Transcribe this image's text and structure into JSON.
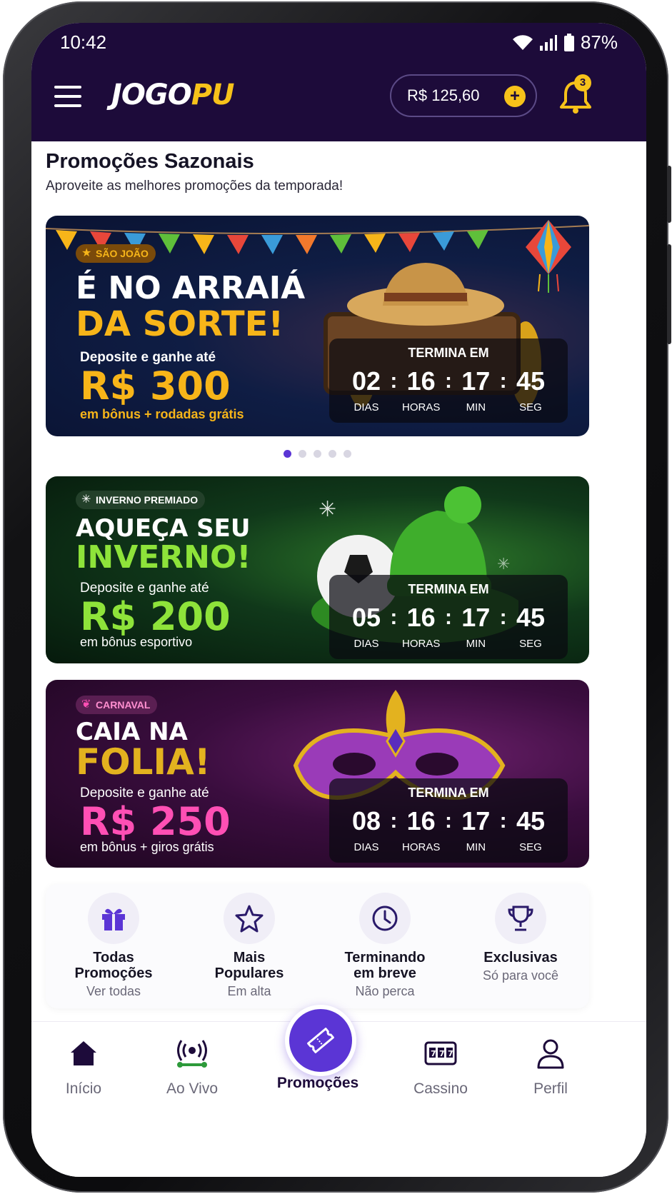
{
  "status_bar": {
    "time": "10:42",
    "battery": "87%"
  },
  "header": {
    "logo_main": "JOGO",
    "logo_accent": "PU",
    "balance": "R$ 125,60",
    "add_symbol": "+",
    "notification_count": "3"
  },
  "section": {
    "title": "Promoções Sazonais",
    "subtitle": "Aproveite as melhores promoções da temporada!"
  },
  "banners": [
    {
      "tag": "SÃO JOÃO",
      "headline_1": "É NO ARRAIÁ",
      "headline_2": "DA SORTE!",
      "deposit": "Deposite e ganhe até",
      "amount": "R$ 300",
      "amount_sub": "em bônus + rodadas grátis",
      "countdown": {
        "title": "TERMINA EM",
        "days": "02",
        "hours": "16",
        "min": "17",
        "sec": "45"
      },
      "accent": "#f7b519"
    },
    {
      "tag": "INVERNO PREMIADO",
      "headline_1": "AQUEÇA SEU",
      "headline_2": "INVERNO!",
      "deposit": "Deposite e ganhe até",
      "amount": "R$ 200",
      "amount_sub": "em bônus esportivo",
      "countdown": {
        "title": "TERMINA EM",
        "days": "05",
        "hours": "16",
        "min": "17",
        "sec": "45"
      },
      "accent": "#8ee33a"
    },
    {
      "tag": "CARNAVAL",
      "headline_1": "CAIA NA",
      "headline_2": "FOLIA!",
      "deposit": "Deposite e ganhe até",
      "amount": "R$ 250",
      "amount_sub": "em bônus + giros grátis",
      "countdown": {
        "title": "TERMINA EM",
        "days": "08",
        "hours": "16",
        "min": "17",
        "sec": "45"
      },
      "accent": "#ff4fb4"
    }
  ],
  "countdown_labels": {
    "days": "DIAS",
    "hours": "HORAS",
    "min": "MIN",
    "sec": "SEG",
    "sep": ":"
  },
  "carousel": {
    "total": 5,
    "active": 1
  },
  "quick_filters": [
    {
      "title": "Todas\nPromoções",
      "subtitle": "Ver todas",
      "icon": "gift-icon"
    },
    {
      "title": "Mais\nPopulares",
      "subtitle": "Em alta",
      "icon": "star-icon"
    },
    {
      "title": "Terminando\nem breve",
      "subtitle": "Não perca",
      "icon": "clock-icon"
    },
    {
      "title": "Exclusivas",
      "subtitle": "Só para você",
      "icon": "trophy-icon"
    }
  ],
  "bottom_nav": [
    {
      "label": "Início",
      "icon": "home-icon"
    },
    {
      "label": "Ao Vivo",
      "icon": "live-broadcast-icon"
    },
    {
      "label": "Promoções",
      "icon": "ticket-icon",
      "active": true
    },
    {
      "label": "Cassino",
      "icon": "slot-machine-icon"
    },
    {
      "label": "Perfil",
      "icon": "user-icon"
    }
  ],
  "colors": {
    "brand_dark": "#1d0b3a",
    "brand_purple": "#5b35d5",
    "brand_yellow": "#f7c21a"
  }
}
